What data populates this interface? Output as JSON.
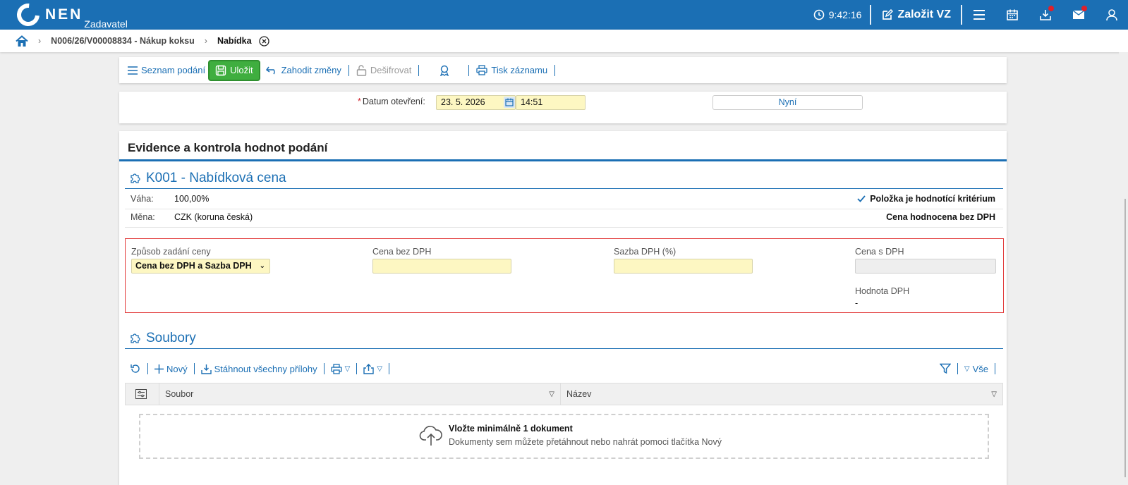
{
  "header": {
    "logo_text": "NEN",
    "logo_sub": "Zadavatel",
    "time": "9:42:16",
    "create_label": "Založit VZ"
  },
  "breadcrumb": {
    "items": [
      "N006/26/V00008834 - Nákup koksu",
      "Nabídka"
    ]
  },
  "toolbar": {
    "list_label": "Seznam podání",
    "save_label": "Uložit",
    "discard_label": "Zahodit změny",
    "decrypt_label": "Dešifrovat",
    "print_label": "Tisk záznamu"
  },
  "opening": {
    "label": "Datum otevření:",
    "date": "23. 5. 2026",
    "time": "14:51",
    "now_label": "Nyní"
  },
  "main": {
    "title": "Evidence a kontrola hodnot podání"
  },
  "criterion": {
    "title": "K001 - Nabídková cena",
    "weight_label": "Váha:",
    "weight_value": "100,00%",
    "currency_label": "Měna:",
    "currency_value": "CZK (koruna česká)",
    "is_criterion": "Položka je hodnotící kritérium",
    "price_mode": "Cena hodnocena bez DPH",
    "fields": {
      "mode_label": "Způsob zadání ceny",
      "mode_value": "Cena bez DPH a Sazba DPH",
      "price_no_vat_label": "Cena bez DPH",
      "price_no_vat_value": "",
      "vat_rate_label": "Sazba DPH (%)",
      "vat_rate_value": "",
      "price_with_vat_label": "Cena s DPH",
      "price_with_vat_value": "",
      "vat_amount_label": "Hodnota DPH",
      "vat_amount_value": "-"
    }
  },
  "files": {
    "title": "Soubory",
    "new_label": "Nový",
    "download_all_label": "Stáhnout všechny přílohy",
    "filter_all_label": "Vše",
    "columns": [
      "Soubor",
      "Název"
    ],
    "empty_title": "Vložte minimálně 1 dokument",
    "empty_sub": "Dokumenty sem můžete přetáhnout nebo nahrát pomoci tlačítka Nový"
  }
}
